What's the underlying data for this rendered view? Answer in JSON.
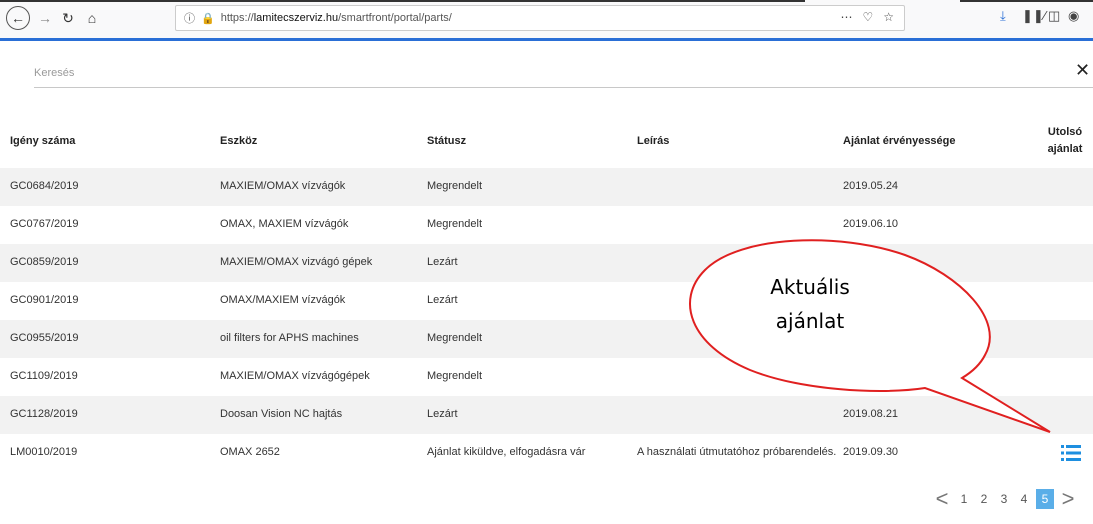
{
  "browser": {
    "url_scheme": "https://",
    "url_host": "lamitecszerviz.hu",
    "url_path": "/smartfront/portal/parts/",
    "icons": [
      "back-icon",
      "forward-icon",
      "reload-icon",
      "home-icon",
      "info-icon",
      "lock-icon",
      "more-icon",
      "pocket-icon",
      "star-icon",
      "download-icon",
      "library-icon",
      "sidebar-icon",
      "extension-icon"
    ]
  },
  "search": {
    "placeholder": "Keresés",
    "value": ""
  },
  "table": {
    "headers": [
      "Igény száma",
      "Eszköz",
      "Státusz",
      "Leírás",
      "Ajánlat érvényessége",
      "Utolsó ajánlat"
    ],
    "rows": [
      [
        "GC0684/2019",
        "MAXIEM/OMAX vízvágók",
        "Megrendelt",
        "",
        "2019.05.24"
      ],
      [
        "GC0767/2019",
        "OMAX, MAXIEM vízvágók",
        "Megrendelt",
        "",
        "2019.06.10"
      ],
      [
        "GC0859/2019",
        "MAXIEM/OMAX vizvágó gépek",
        "Lezárt",
        "",
        ""
      ],
      [
        "GC0901/2019",
        "OMAX/MAXIEM vízvágók",
        "Lezárt",
        "",
        ""
      ],
      [
        "GC0955/2019",
        "oil filters for APHS machines",
        "Megrendelt",
        "",
        ""
      ],
      [
        "GC1109/2019",
        "MAXIEM/OMAX vízvágógépek",
        "Megrendelt",
        "",
        ""
      ],
      [
        "GC1128/2019",
        "Doosan Vision NC hajtás",
        "Lezárt",
        "",
        "2019.08.21"
      ],
      [
        "LM0010/2019",
        "OMAX 2652",
        "Ajánlat kiküldve, elfogadásra vár",
        "A használati útmutatóhoz próbarendelés.",
        "2019.09.30"
      ]
    ],
    "last_row_icon": "list-icon"
  },
  "pagination": {
    "prev": "<",
    "pages": [
      "1",
      "2",
      "3",
      "4",
      "5"
    ],
    "active": "5",
    "next": ">"
  },
  "callout": {
    "line1": "Aktuális",
    "line2": "ajánlat"
  },
  "colors": {
    "accent": "#2a6fd6",
    "callout_stroke": "#e02020",
    "list_icon": "#1e8fe0",
    "active_page": "#5aaee8"
  }
}
